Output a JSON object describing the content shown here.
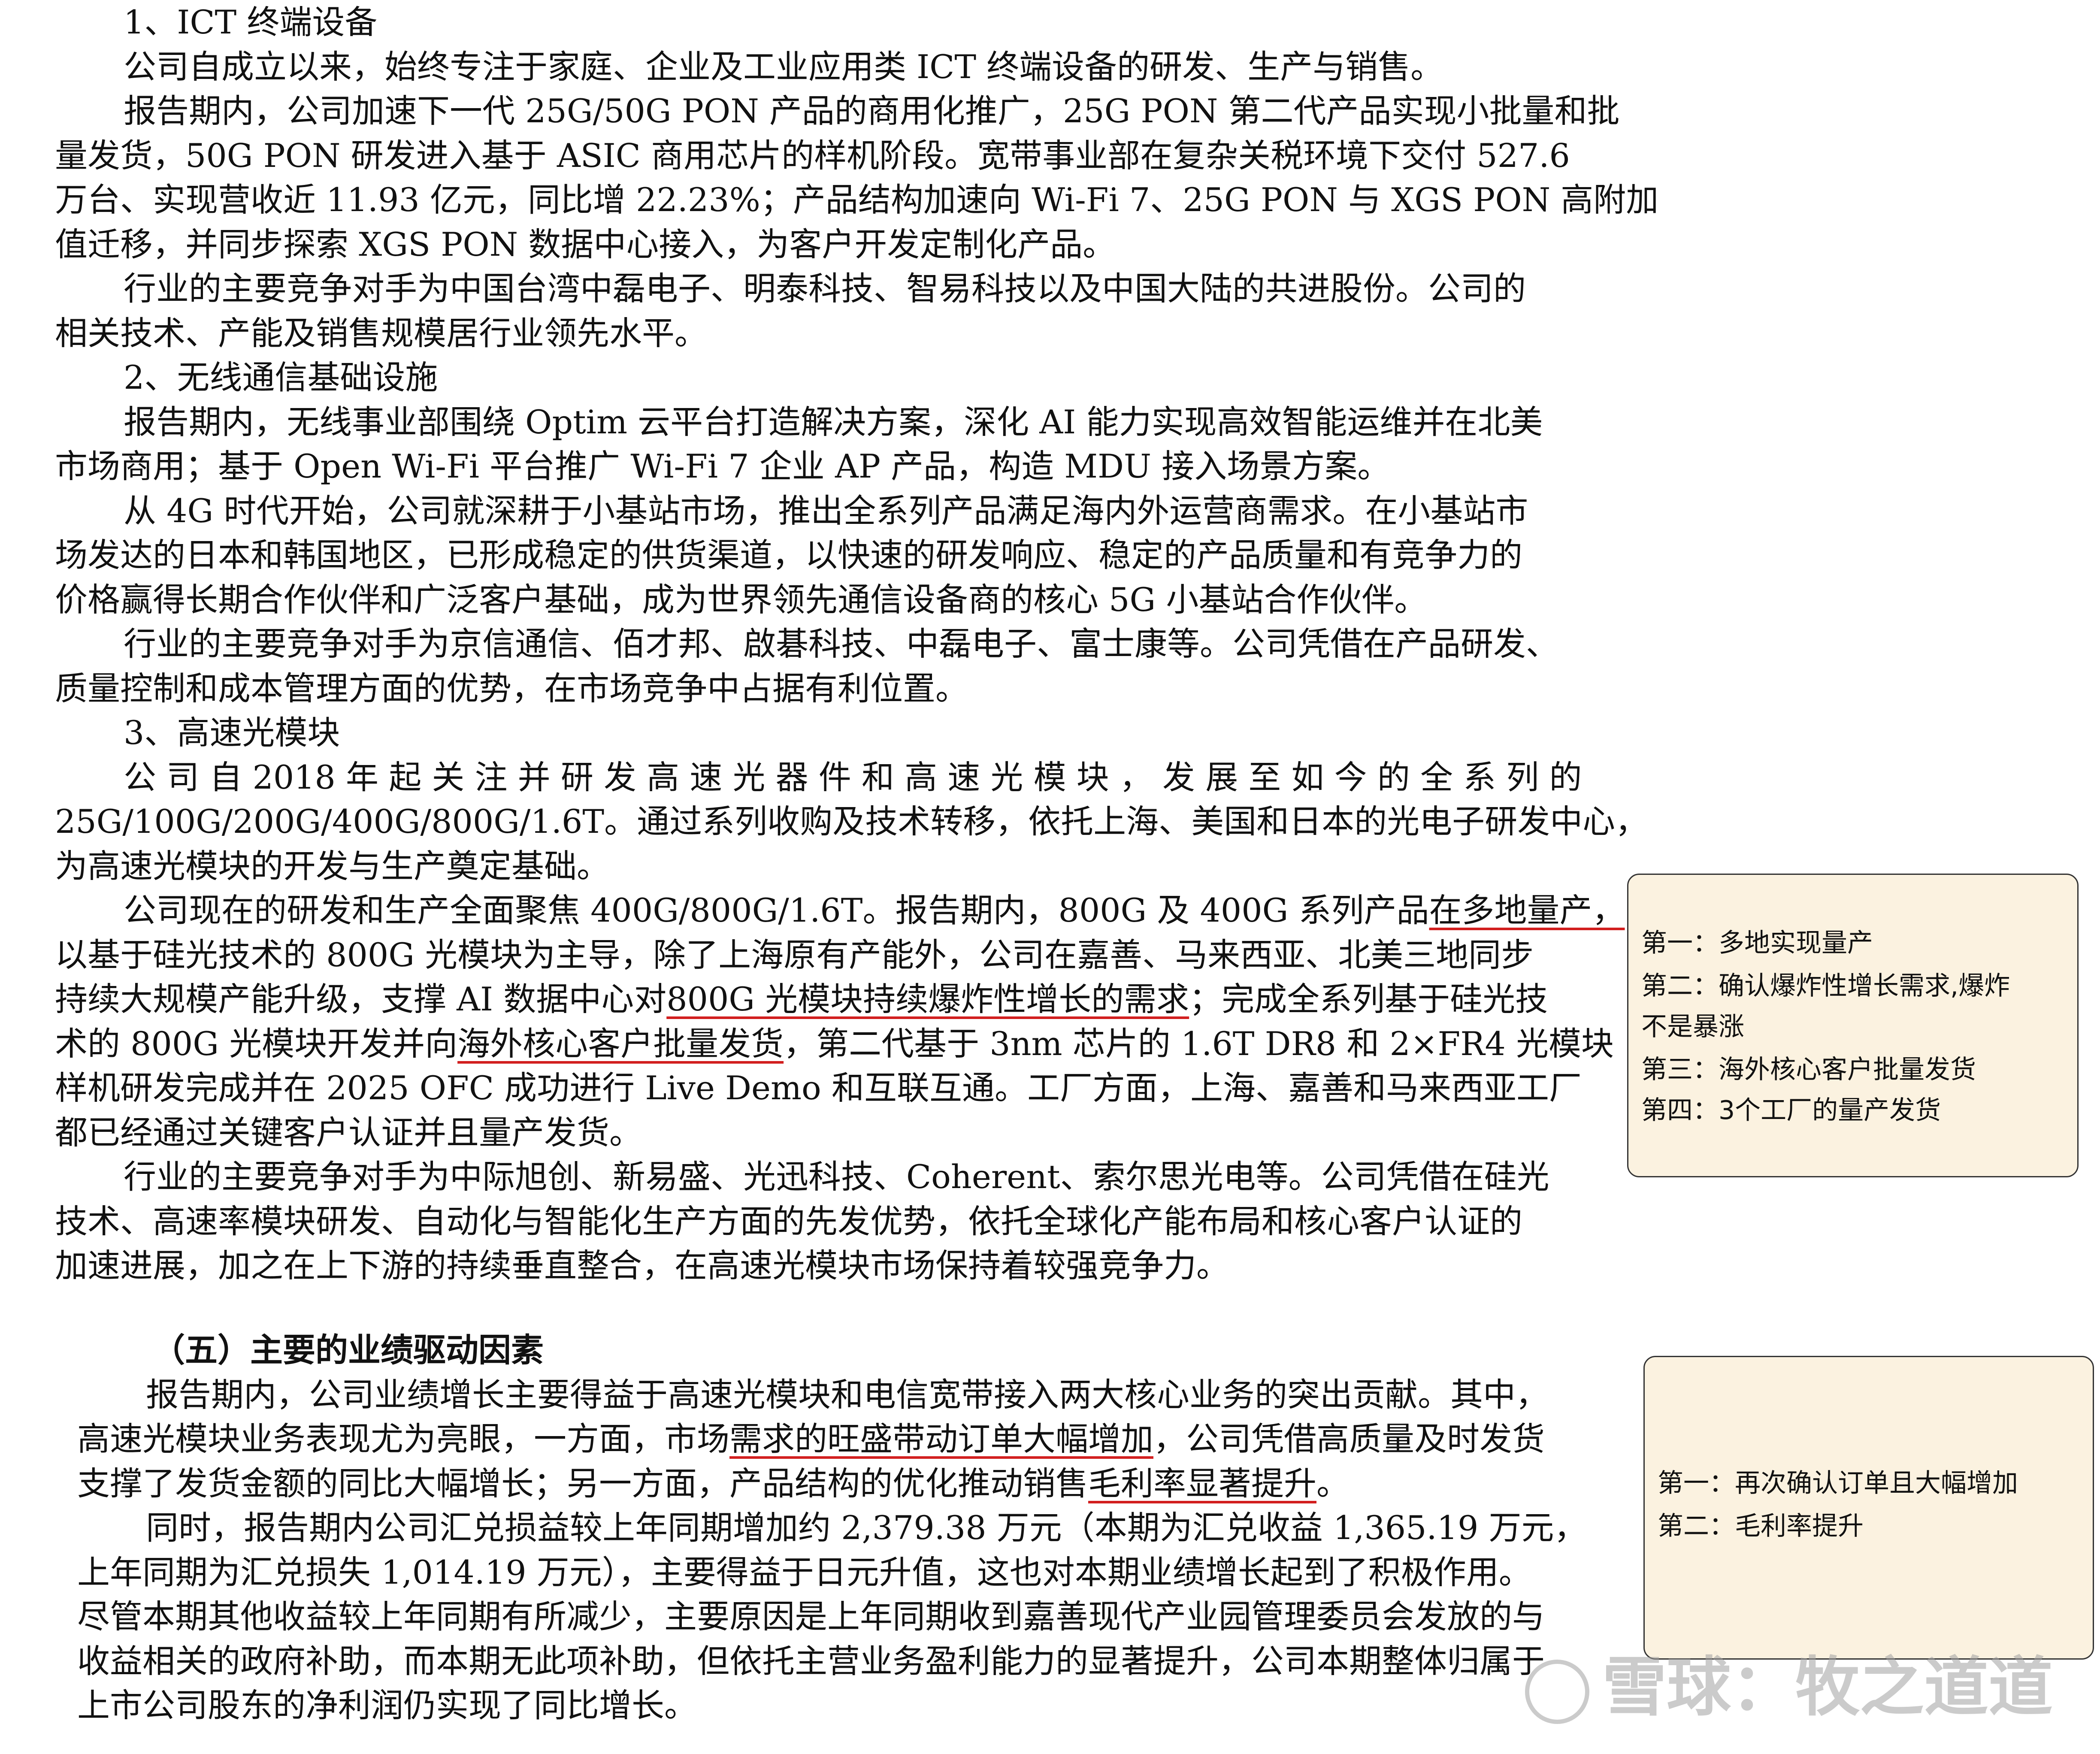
{
  "s1": {
    "title": "1、ICT 终端设备",
    "l1": "公司自成立以来，始终专注于家庭、企业及工业应用类 ICT 终端设备的研发、生产与销售。",
    "l2": "报告期内，公司加速下一代 25G/50G PON 产品的商用化推广，25G PON 第二代产品实现小批量和批",
    "l3": "量发货，50G PON 研发进入基于 ASIC 商用芯片的样机阶段。宽带事业部在复杂关税环境下交付 527.6",
    "l4": "万台、实现营收近 11.93 亿元，同比增 22.23%；产品结构加速向 Wi-Fi 7、25G PON 与 XGS PON 高附加",
    "l5": "值迁移，并同步探索 XGS PON 数据中心接入，为客户开发定制化产品。",
    "l6": "行业的主要竞争对手为中国台湾中磊电子、明泰科技、智易科技以及中国大陆的共进股份。公司的",
    "l7": "相关技术、产能及销售规模居行业领先水平。"
  },
  "s2": {
    "title": "2、无线通信基础设施",
    "l1": "报告期内，无线事业部围绕 Optim 云平台打造解决方案，深化 AI 能力实现高效智能运维并在北美",
    "l2": "市场商用；基于 Open Wi-Fi 平台推广 Wi-Fi 7 企业 AP 产品，构造 MDU 接入场景方案。",
    "l3": "从 4G 时代开始，公司就深耕于小基站市场，推出全系列产品满足海内外运营商需求。在小基站市",
    "l4": "场发达的日本和韩国地区，已形成稳定的供货渠道，以快速的研发响应、稳定的产品质量和有竞争力的",
    "l5": "价格赢得长期合作伙伴和广泛客户基础，成为世界领先通信设备商的核心 5G 小基站合作伙伴。",
    "l6": "行业的主要竞争对手为京信通信、佰才邦、啟碁科技、中磊电子、富士康等。公司凭借在产品研发、",
    "l7": "质量控制和成本管理方面的优势，在市场竞争中占据有利位置。"
  },
  "s3": {
    "title": "3、高速光模块",
    "l1": "公 司 自 2018 年 起 关 注 并 研 发 高 速 光 器 件 和 高 速 光 模 块 ， 发 展 至 如 今 的 全 系 列 的",
    "l2": "25G/100G/200G/400G/800G/1.6T。通过系列收购及技术转移，依托上海、美国和日本的光电子研发中心，",
    "l3": "为高速光模块的开发与生产奠定基础。",
    "l4a": "公司现在的研发和生产全面聚焦 400G/800G/1.6T。报告期内，800G 及 400G 系列产品",
    "l4b": "在多地量产，",
    "l5": "以基于硅光技术的 800G 光模块为主导，除了上海原有产能外，公司在嘉善、马来西亚、北美三地同步",
    "l6a": "持续大规模产能升级，支撑 AI 数据中心对",
    "l6b": "800G 光模块持续爆炸性增长的需求",
    "l6c": "；完成全系列基于硅光技",
    "l7a": "术的 800G 光模块开发并向",
    "l7b": "海外核心客户批量发货",
    "l7c": "，第二代基于 3nm 芯片的 1.6T DR8 和 2×FR4 光模块",
    "l8": "样机研发完成并在 2025 OFC 成功进行 Live Demo 和互联互通。工厂方面，上海、嘉善和马来西亚工厂",
    "l9": "都已经通过关键客户认证并且量产发货。",
    "l10": "行业的主要竞争对手为中际旭创、新易盛、光迅科技、Coherent、索尔思光电等。公司凭借在硅光",
    "l11": "技术、高速率模块研发、自动化与智能化生产方面的先发优势，依托全球化产能布局和核心客户认证的",
    "l12": "加速进展，加之在上下游的持续垂直整合，在高速光模块市场保持着较强竞争力。"
  },
  "s5": {
    "title": "（五）主要的业绩驱动因素",
    "l1": "报告期内，公司业绩增长主要得益于高速光模块和电信宽带接入两大核心业务的突出贡献。其中，",
    "l2a": "高速光模块业务表现尤为亮眼，一方面，市场",
    "l2b": "需求的旺盛带动订单大幅增加",
    "l2c": "，公司凭借高质量及时发货",
    "l3a": "支撑了发货金额的同比大幅增长；另一方面，产品结构的优化推动销售",
    "l3b": "毛利率显著提升",
    "l3c": "。",
    "l4": "同时，报告期内公司汇兑损益较上年同期增加约 2,379.38 万元（本期为汇兑收益 1,365.19 万元，",
    "l5": "上年同期为汇兑损失 1,014.19 万元），主要得益于日元升值，这也对本期业绩增长起到了积极作用。",
    "l6": "尽管本期其他收益较上年同期有所减少，主要原因是上年同期收到嘉善现代产业园管理委员会发放的与",
    "l7": "收益相关的政府补助，而本期无此项补助，但依托主营业务盈利能力的显著提升，公司本期整体归属于",
    "l8": "上市公司股东的净利润仍实现了同比增长。"
  },
  "note1": {
    "l1": "第一：多地实现量产",
    "l2": "第二：确认爆炸性增长需求,爆炸",
    "l3": "不是暴涨",
    "l4": "第三：海外核心客户批量发货",
    "l5": "第四：3个工厂的量产发货"
  },
  "note2": {
    "l1": "第一：再次确认订单且大幅增加",
    "l2": "第二：毛利率提升"
  },
  "watermark": "雪球：牧之道道",
  "colors": {
    "underline": "#d21f1f",
    "note_bg": "#fbf2e0"
  }
}
